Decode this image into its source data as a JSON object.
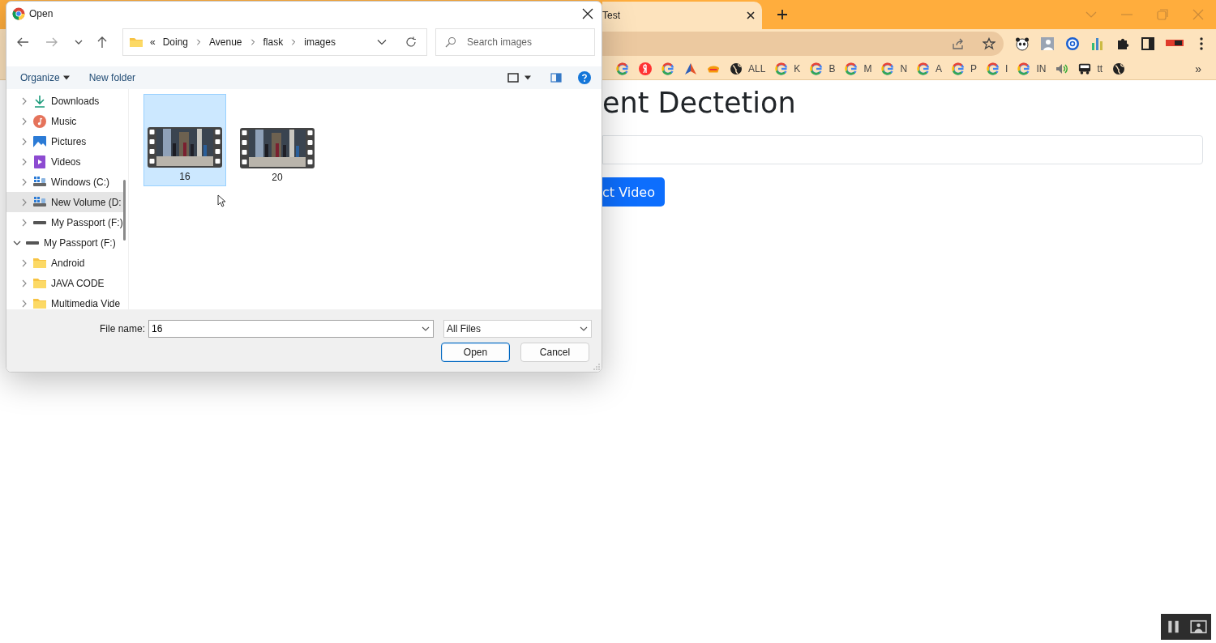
{
  "browser": {
    "tab": {
      "title": "Test",
      "selected": true
    },
    "bookmarks": [
      {
        "kind": "google"
      },
      {
        "kind": "yandex"
      },
      {
        "kind": "google"
      },
      {
        "kind": "triangle"
      },
      {
        "kind": "badge"
      },
      {
        "kind": "globe",
        "label": "ALL"
      },
      {
        "kind": "google",
        "label": "K"
      },
      {
        "kind": "google",
        "label": "B"
      },
      {
        "kind": "google",
        "label": "M"
      },
      {
        "kind": "google",
        "label": "N"
      },
      {
        "kind": "google",
        "label": "A"
      },
      {
        "kind": "google",
        "label": "P"
      },
      {
        "kind": "google",
        "label": "I"
      },
      {
        "kind": "google",
        "label": "IN"
      },
      {
        "kind": "speaker"
      },
      {
        "kind": "bus",
        "label": "tt"
      },
      {
        "kind": "globe"
      }
    ],
    "bookmarks_overflow": "»"
  },
  "page": {
    "heading": "ent Dectetion",
    "button": "ct Video"
  },
  "dialog": {
    "title": "Open",
    "path_overflow": "«",
    "path": [
      "Doing",
      "Avenue",
      "flask",
      "images"
    ],
    "search": {
      "placeholder": "Search images"
    },
    "commands": [
      "Organize",
      "New folder"
    ],
    "tree": [
      {
        "children": [
          {
            "label": "Downloads",
            "kind": "download",
            "selected": false,
            "expanded": false
          },
          {
            "label": "Music",
            "kind": "music",
            "selected": false,
            "expanded": false
          },
          {
            "label": "Pictures",
            "kind": "pictures",
            "selected": false,
            "expanded": false
          },
          {
            "label": "Videos",
            "kind": "videos",
            "selected": false,
            "expanded": false
          },
          {
            "label": "Windows (C:)",
            "kind": "osdrive",
            "selected": false,
            "expanded": false
          },
          {
            "label": "New Volume (D:",
            "kind": "osdrive",
            "selected": true,
            "expanded": false
          },
          {
            "label": "My Passport (F:)",
            "kind": "drive",
            "selected": false,
            "expanded": false
          }
        ]
      },
      {
        "label": "My Passport (F:)",
        "kind": "drive",
        "selected": false,
        "expanded": true,
        "children": [
          {
            "label": "Android",
            "kind": "folder",
            "selected": false,
            "expanded": false
          },
          {
            "label": "JAVA CODE",
            "kind": "folder",
            "selected": false,
            "expanded": false
          },
          {
            "label": "Multimedia Vide",
            "kind": "folder",
            "selected": false,
            "expanded": false
          }
        ]
      }
    ],
    "files": [
      {
        "name": "16",
        "selected": true
      },
      {
        "name": "20",
        "selected": false
      }
    ],
    "file_name_label": "File name:",
    "file_name": "16",
    "file_type": "All Files",
    "buttons": [
      {
        "label": "Open",
        "default": true
      },
      {
        "label": "Cancel",
        "default": false
      }
    ]
  }
}
